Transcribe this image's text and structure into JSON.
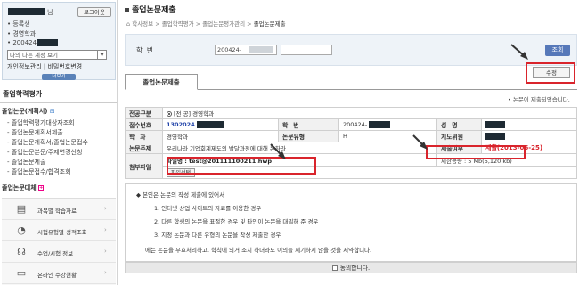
{
  "user": {
    "name_suffix": "님",
    "logout_label": "로그아웃",
    "status": "• 등록생",
    "department": "• 경영학과",
    "student_id_prefix": "• 200424-",
    "switch_placeholder": "나의 다른 계정 보기",
    "account_links": "개인정보관리 | 비밀번호변경",
    "more_label": "더보기"
  },
  "sidebar": {
    "title": "졸업학력평가",
    "main_item": "졸업논문(계획서)",
    "main_toggle": "⊟",
    "sub_items": [
      "- 졸업학력평가대상자조회",
      "- 졸업논문계획서제출",
      "- 졸업논문계획서/졸업논문접수",
      "- 졸업논문본문/주제변경신청",
      "- 졸업논문제출",
      "- 졸업논문접수/합격조회"
    ],
    "cancel_item": "졸업논문대체"
  },
  "quick_links": [
    {
      "label": "과목별 학습자료",
      "icon": "book-icon"
    },
    {
      "label": "시험유형별 성적조회",
      "icon": "chart-icon"
    },
    {
      "label": "수업/시험 정보",
      "icon": "headset-icon"
    },
    {
      "label": "온라인 수강현황",
      "icon": "monitor-icon"
    }
  ],
  "page": {
    "title": "졸업논문제출",
    "breadcrumb": [
      "학사정보",
      "졸업학력평가",
      "졸업논문평가관리"
    ],
    "breadcrumb_current": "졸업논문제출",
    "separator": ">"
  },
  "search": {
    "student_id_label": "학번",
    "student_id_value": "200424-",
    "button_label": "조회"
  },
  "tabs": [
    {
      "label": "졸업논문제출"
    }
  ],
  "edit_button": "수정",
  "notice": "• 논문이 제출되었습니다.",
  "table": {
    "major_label": "전공구분",
    "major_value": "[전    공] 경영학과",
    "receipt_label": "접수번호",
    "receipt_value": "1302024",
    "sid_label": "학번",
    "sid_value": "200424-",
    "name_label": "성명",
    "dept_label": "학과",
    "dept_value": "경영학과",
    "thesis_type_label": "논문유형",
    "thesis_type_value": "H",
    "advisor_label": "지도위원",
    "topic_label": "논문주제",
    "topic_value": "우리나라 기업회계제도의 발달과정에 대해 논하라",
    "status_label": "제출여부",
    "status_value": "제출(2013-06-25)",
    "attachment_label": "첨부파일",
    "file_name": "파일명 : test@201111100211.hwp",
    "file_select_label": "파일선택",
    "size_limit": "제한용량 : 5 Mb(5,120 kb)"
  },
  "pledge": {
    "heading": "본인은 논문의 작성 제출에 있어서",
    "items": [
      "1. 인터넷 상업 사이트의 자료를 이용한 경우",
      "2. 다른 학생의 논문을 표절한 경우 및 타인이 논문을 대필해 준 경우",
      "3. 지정 논문과 다른 유형의 논문을 작성 제출한 경우"
    ],
    "closing": "에는 논문을 무효처리하고, 학칙에 의거 조치 하더라도 이의를 제기하지 않을 것을 서약합니다.",
    "agree_label": "동의합니다."
  },
  "colors": {
    "accent": "#d9242c",
    "button_blue": "#5678b9"
  }
}
